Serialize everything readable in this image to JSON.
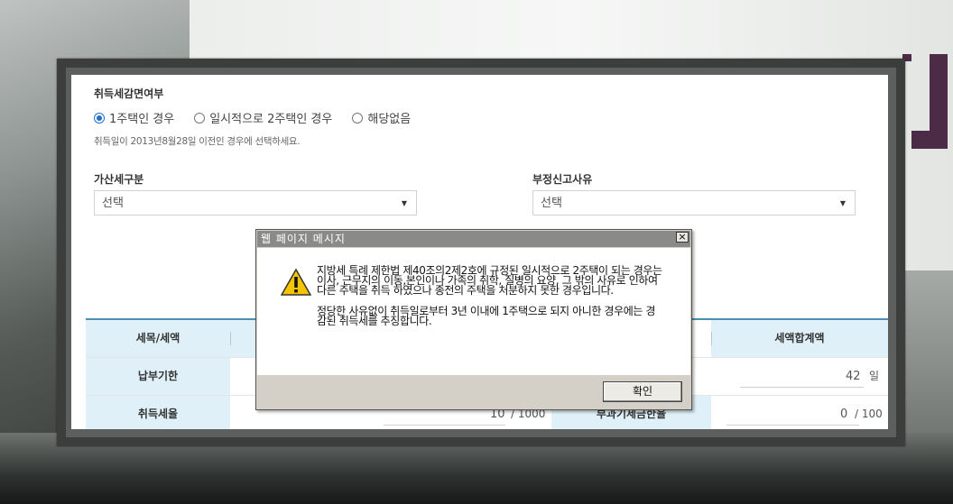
{
  "form": {
    "reduction_title": "취득세감면여부",
    "radio_options": [
      {
        "label": "1주택인 경우",
        "checked": true
      },
      {
        "label": "일시적으로 2주택인 경우",
        "checked": false
      },
      {
        "label": "해당없음",
        "checked": false
      }
    ],
    "hint": "취득일이 2013년8월28일 이전인 경우에 선택하세요.",
    "surcharge_label": "가산세구분",
    "surcharge_value": "선택",
    "unfair_label": "부정신고사유",
    "unfair_value": "선택"
  },
  "table": {
    "headers": {
      "tax_item": "세목/세액",
      "total": "세액합계액"
    },
    "rows": [
      {
        "label": "납부기한",
        "right_value": "42",
        "right_unit": "일"
      },
      {
        "label": "취득세율",
        "mid_value": "10",
        "mid_unit": "/ 1000",
        "mid_label": "부과기세금한율",
        "right_value": "0",
        "right_unit": "/ 100"
      }
    ]
  },
  "dialog": {
    "title": "웹 페이지 메시지",
    "close_label": "×",
    "icon": "warning-icon",
    "paragraph1": "지방세 특례 제한법 제40조의2제2호에 규정된 일시적으로 2주택이 되는 경우는 이사, 근무지의 이동,본인이나 가족의 취학, 질병의 요양, 그 밖의 사유로 인하여 다른 주택을 취득 하였으나 종전의 주택을 처분하지 못한 경우입니다.",
    "paragraph2": "정당한 사유없이 취득일로부터 3년 이내에 1주택으로 되지 아니한 경우에는 경감된 취득세를 추징합니다.",
    "ok_label": "확인"
  },
  "colors": {
    "accent": "#1f6fc6",
    "table_header": "#dff0f8",
    "dialog_bg": "#d4d0c8"
  }
}
